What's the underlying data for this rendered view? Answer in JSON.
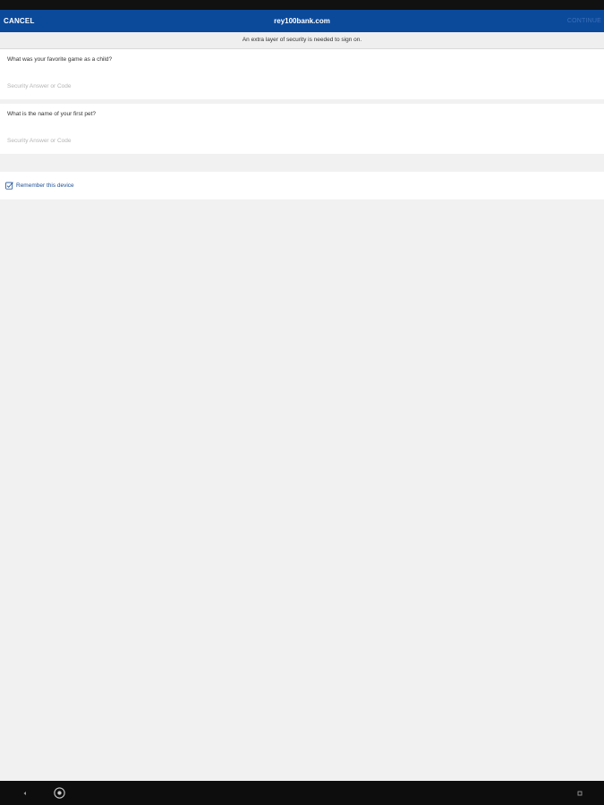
{
  "app_bar": {
    "cancel_label": "CANCEL",
    "title": "rey100bank.com",
    "continue_label": "CONTINUE",
    "background_color": "#0b4a9b"
  },
  "info_message": "An extra layer of security is needed to sign on.",
  "security_questions": [
    {
      "question": "What was your favorite game as a child?",
      "answer_placeholder": "Security Answer or Code",
      "answer_value": ""
    },
    {
      "question": "What is the name of your first pet?",
      "answer_placeholder": "Security Answer or Code",
      "answer_value": ""
    }
  ],
  "remember_device": {
    "label": "Remember this device",
    "checked": false,
    "icon": "checkbox-icon"
  },
  "system_nav": {
    "icons": [
      "back-icon",
      "home-icon",
      "menu-icon"
    ]
  }
}
